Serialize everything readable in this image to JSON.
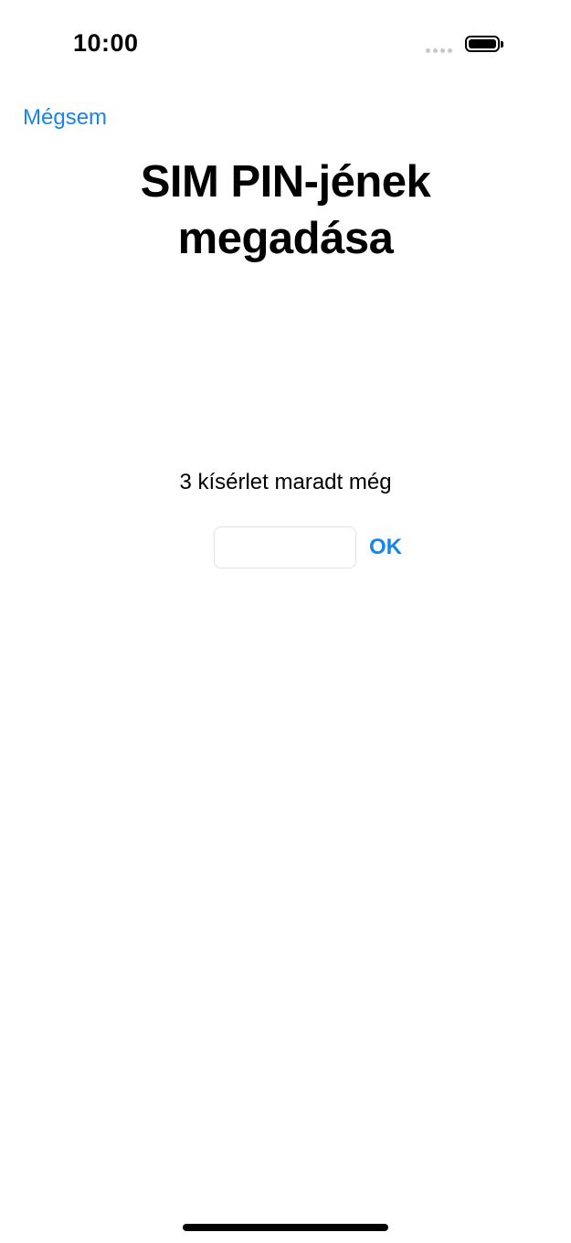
{
  "status_bar": {
    "time": "10:00",
    "icons": [
      "signal-dots-icon",
      "battery-icon"
    ]
  },
  "nav": {
    "cancel_label": "Mégsem"
  },
  "title": "SIM PIN-jének megadása",
  "attempts_text": "3 kísérlet maradt még",
  "pin_field": {
    "value": "",
    "placeholder": ""
  },
  "ok_label": "OK",
  "colors": {
    "accent": "#1a85e8",
    "text": "#000000",
    "background": "#ffffff",
    "field_border": "#e0e0e0"
  }
}
